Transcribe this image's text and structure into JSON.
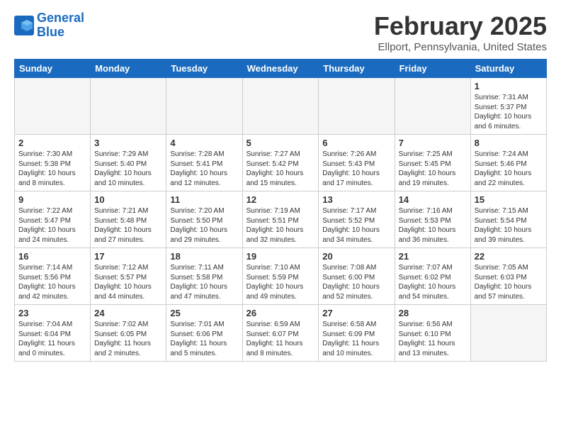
{
  "header": {
    "logo_line1": "General",
    "logo_line2": "Blue",
    "title": "February 2025",
    "location": "Ellport, Pennsylvania, United States"
  },
  "weekdays": [
    "Sunday",
    "Monday",
    "Tuesday",
    "Wednesday",
    "Thursday",
    "Friday",
    "Saturday"
  ],
  "weeks": [
    [
      {
        "num": "",
        "info": ""
      },
      {
        "num": "",
        "info": ""
      },
      {
        "num": "",
        "info": ""
      },
      {
        "num": "",
        "info": ""
      },
      {
        "num": "",
        "info": ""
      },
      {
        "num": "",
        "info": ""
      },
      {
        "num": "1",
        "info": "Sunrise: 7:31 AM\nSunset: 5:37 PM\nDaylight: 10 hours and 6 minutes."
      }
    ],
    [
      {
        "num": "2",
        "info": "Sunrise: 7:30 AM\nSunset: 5:38 PM\nDaylight: 10 hours and 8 minutes."
      },
      {
        "num": "3",
        "info": "Sunrise: 7:29 AM\nSunset: 5:40 PM\nDaylight: 10 hours and 10 minutes."
      },
      {
        "num": "4",
        "info": "Sunrise: 7:28 AM\nSunset: 5:41 PM\nDaylight: 10 hours and 12 minutes."
      },
      {
        "num": "5",
        "info": "Sunrise: 7:27 AM\nSunset: 5:42 PM\nDaylight: 10 hours and 15 minutes."
      },
      {
        "num": "6",
        "info": "Sunrise: 7:26 AM\nSunset: 5:43 PM\nDaylight: 10 hours and 17 minutes."
      },
      {
        "num": "7",
        "info": "Sunrise: 7:25 AM\nSunset: 5:45 PM\nDaylight: 10 hours and 19 minutes."
      },
      {
        "num": "8",
        "info": "Sunrise: 7:24 AM\nSunset: 5:46 PM\nDaylight: 10 hours and 22 minutes."
      }
    ],
    [
      {
        "num": "9",
        "info": "Sunrise: 7:22 AM\nSunset: 5:47 PM\nDaylight: 10 hours and 24 minutes."
      },
      {
        "num": "10",
        "info": "Sunrise: 7:21 AM\nSunset: 5:48 PM\nDaylight: 10 hours and 27 minutes."
      },
      {
        "num": "11",
        "info": "Sunrise: 7:20 AM\nSunset: 5:50 PM\nDaylight: 10 hours and 29 minutes."
      },
      {
        "num": "12",
        "info": "Sunrise: 7:19 AM\nSunset: 5:51 PM\nDaylight: 10 hours and 32 minutes."
      },
      {
        "num": "13",
        "info": "Sunrise: 7:17 AM\nSunset: 5:52 PM\nDaylight: 10 hours and 34 minutes."
      },
      {
        "num": "14",
        "info": "Sunrise: 7:16 AM\nSunset: 5:53 PM\nDaylight: 10 hours and 36 minutes."
      },
      {
        "num": "15",
        "info": "Sunrise: 7:15 AM\nSunset: 5:54 PM\nDaylight: 10 hours and 39 minutes."
      }
    ],
    [
      {
        "num": "16",
        "info": "Sunrise: 7:14 AM\nSunset: 5:56 PM\nDaylight: 10 hours and 42 minutes."
      },
      {
        "num": "17",
        "info": "Sunrise: 7:12 AM\nSunset: 5:57 PM\nDaylight: 10 hours and 44 minutes."
      },
      {
        "num": "18",
        "info": "Sunrise: 7:11 AM\nSunset: 5:58 PM\nDaylight: 10 hours and 47 minutes."
      },
      {
        "num": "19",
        "info": "Sunrise: 7:10 AM\nSunset: 5:59 PM\nDaylight: 10 hours and 49 minutes."
      },
      {
        "num": "20",
        "info": "Sunrise: 7:08 AM\nSunset: 6:00 PM\nDaylight: 10 hours and 52 minutes."
      },
      {
        "num": "21",
        "info": "Sunrise: 7:07 AM\nSunset: 6:02 PM\nDaylight: 10 hours and 54 minutes."
      },
      {
        "num": "22",
        "info": "Sunrise: 7:05 AM\nSunset: 6:03 PM\nDaylight: 10 hours and 57 minutes."
      }
    ],
    [
      {
        "num": "23",
        "info": "Sunrise: 7:04 AM\nSunset: 6:04 PM\nDaylight: 11 hours and 0 minutes."
      },
      {
        "num": "24",
        "info": "Sunrise: 7:02 AM\nSunset: 6:05 PM\nDaylight: 11 hours and 2 minutes."
      },
      {
        "num": "25",
        "info": "Sunrise: 7:01 AM\nSunset: 6:06 PM\nDaylight: 11 hours and 5 minutes."
      },
      {
        "num": "26",
        "info": "Sunrise: 6:59 AM\nSunset: 6:07 PM\nDaylight: 11 hours and 8 minutes."
      },
      {
        "num": "27",
        "info": "Sunrise: 6:58 AM\nSunset: 6:09 PM\nDaylight: 11 hours and 10 minutes."
      },
      {
        "num": "28",
        "info": "Sunrise: 6:56 AM\nSunset: 6:10 PM\nDaylight: 11 hours and 13 minutes."
      },
      {
        "num": "",
        "info": ""
      }
    ]
  ]
}
